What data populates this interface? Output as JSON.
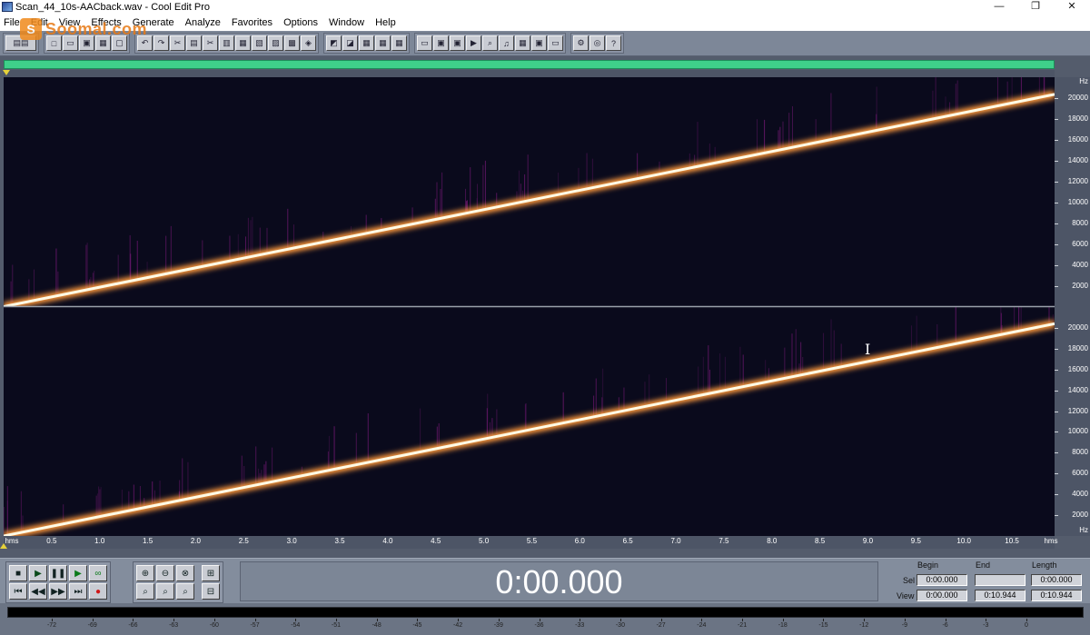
{
  "window": {
    "title": "Scan_44_10s-AACback.wav - Cool Edit Pro",
    "controls": [
      "—",
      "❐",
      "✕"
    ]
  },
  "watermark": {
    "text": "Soomal.com",
    "mark": "S"
  },
  "menu": [
    "File",
    "Edit",
    "View",
    "Effects",
    "Generate",
    "Analyze",
    "Favorites",
    "Options",
    "Window",
    "Help"
  ],
  "toolbar_groups": [
    [
      "multitrack-icon"
    ],
    [
      "new-icon",
      "open-icon",
      "save-icon",
      "save-all-icon",
      "close-icon"
    ],
    [
      "undo-icon",
      "redo-icon",
      "repeat-icon",
      "copy-icon",
      "cut-icon",
      "paste-icon",
      "paste-new-icon",
      "mix-paste-icon",
      "trim-icon",
      "crop-icon",
      "convert-icon"
    ],
    [
      "spectral-view-icon",
      "waveform-view-icon",
      "show-cues-icon",
      "show-markers-icon",
      "show-grid-icon"
    ],
    [
      "window-icon",
      "save-selection-icon",
      "settings-icon",
      "play-icon",
      "zoom-icon",
      "sample-rate-icon",
      "info-icon",
      "preview-icon",
      "toggle-icon"
    ],
    [
      "scripts-icon",
      "cd-icon",
      "help-icon"
    ]
  ],
  "freq_ruler": {
    "unit": "Hz",
    "labels": [
      "20000",
      "18000",
      "16000",
      "14000",
      "12000",
      "10000",
      "8000",
      "6000",
      "4000",
      "2000"
    ]
  },
  "time_ruler": {
    "unit": "hms",
    "labels": [
      "0.5",
      "1.0",
      "1.5",
      "2.0",
      "2.5",
      "3.0",
      "3.5",
      "4.0",
      "4.5",
      "5.0",
      "5.5",
      "6.0",
      "6.5",
      "7.0",
      "7.5",
      "8.0",
      "8.5",
      "9.0",
      "9.5",
      "10.0",
      "10.5"
    ]
  },
  "spectrogram": {
    "channels": 2,
    "duration_s": 10.944,
    "max_freq_hz": 22050,
    "sweep_start_hz": 0,
    "sweep_end_hz": 20400,
    "colors": {
      "background": "#0a0a1c",
      "sweep_core": "#fffbe6",
      "sweep_glow": "#ff9a3c",
      "noise": "#7a1a7a"
    }
  },
  "transport": {
    "buttons_row1": [
      "stop-icon",
      "play-icon",
      "pause-icon",
      "play-to-end-icon",
      "loop-icon"
    ],
    "buttons_row2": [
      "go-to-start-icon",
      "rewind-icon",
      "fast-forward-icon",
      "go-to-end-icon",
      "record-icon"
    ],
    "zoom_row1": [
      "zoom-in-icon",
      "zoom-out-icon",
      "zoom-full-icon",
      "zoom-vertical-in-icon"
    ],
    "zoom_row2": [
      "zoom-left-icon",
      "zoom-right-icon",
      "zoom-selection-icon",
      "zoom-vertical-out-icon"
    ],
    "time": "0:00.000"
  },
  "selection": {
    "headers": {
      "begin": "Begin",
      "end": "End",
      "length": "Length"
    },
    "sel": {
      "label": "Sel",
      "begin": "0:00.000",
      "end": "",
      "length": "0:00.000"
    },
    "view": {
      "label": "View",
      "begin": "0:00.000",
      "end": "0:10.944",
      "length": "0:10.944"
    }
  },
  "level_meter": {
    "labels": [
      "-72",
      "-69",
      "-66",
      "-63",
      "-60",
      "-57",
      "-54",
      "-51",
      "-48",
      "-45",
      "-42",
      "-39",
      "-36",
      "-33",
      "-30",
      "-27",
      "-24",
      "-21",
      "-18",
      "-15",
      "-12",
      "-9",
      "-6",
      "-3",
      "0"
    ]
  },
  "glyphs": {
    "multitrack-icon": "▤▤",
    "new-icon": "□",
    "open-icon": "▭",
    "save-icon": "▣",
    "save-all-icon": "▦",
    "close-icon": "▢",
    "undo-icon": "↶",
    "redo-icon": "↷",
    "repeat-icon": "✂",
    "copy-icon": "▤",
    "cut-icon": "✂",
    "paste-icon": "▥",
    "paste-new-icon": "▦",
    "mix-paste-icon": "▧",
    "trim-icon": "▨",
    "crop-icon": "▩",
    "convert-icon": "◈",
    "spectral-view-icon": "◩",
    "waveform-view-icon": "◪",
    "show-cues-icon": "▦",
    "show-markers-icon": "▦",
    "show-grid-icon": "▦",
    "window-icon": "▭",
    "save-selection-icon": "▣",
    "settings-icon": "▣",
    "play-icon": "▶",
    "zoom-icon": "⌕",
    "sample-rate-icon": "♫",
    "info-icon": "▦",
    "preview-icon": "▣",
    "toggle-icon": "▭",
    "scripts-icon": "⚙",
    "cd-icon": "◎",
    "help-icon": "?",
    "stop-icon": "■",
    "pause-icon": "❚❚",
    "play-to-end-icon": "▶",
    "loop-icon": "∞",
    "go-to-start-icon": "⏮",
    "rewind-icon": "◀◀",
    "fast-forward-icon": "▶▶",
    "go-to-end-icon": "⏭",
    "record-icon": "●",
    "zoom-in-icon": "⊕",
    "zoom-out-icon": "⊖",
    "zoom-full-icon": "⊗",
    "zoom-vertical-in-icon": "⊞",
    "zoom-left-icon": "⌕",
    "zoom-right-icon": "⌕",
    "zoom-selection-icon": "⌕",
    "zoom-vertical-out-icon": "⊟"
  }
}
